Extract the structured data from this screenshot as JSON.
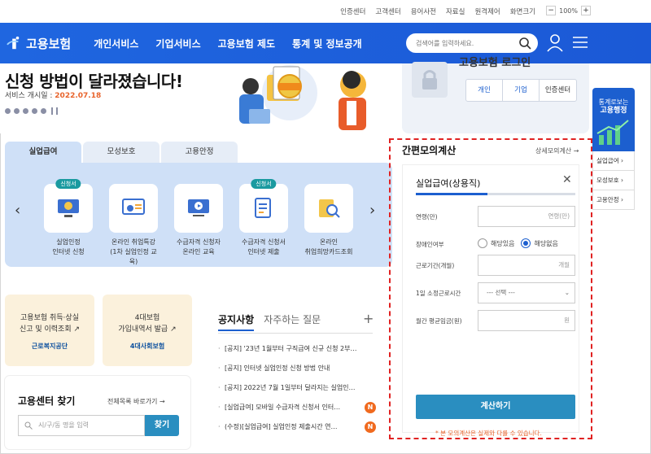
{
  "util": {
    "links": [
      "인증센터",
      "고객센터",
      "용어사전",
      "자료실",
      "원격제어",
      "화면크기"
    ],
    "zoom": {
      "minus": "−",
      "value": "100%",
      "plus": "+"
    }
  },
  "header": {
    "logo": "고용보험",
    "nav": [
      "개인서비스",
      "기업서비스",
      "고용보험 제도",
      "통계 및 정보공개"
    ],
    "search_placeholder": "검색어를 입력하세요."
  },
  "hero": {
    "title": "신청 방법이 달라졌습니다!",
    "date_label": "서비스 개시일 : ",
    "date_value": "2022.07.18"
  },
  "login": {
    "title": "고용보험 로그인",
    "buttons": [
      "개인",
      "기업",
      "인증센터"
    ]
  },
  "tabs": [
    "실업급여",
    "모성보호",
    "고용안정"
  ],
  "services": [
    {
      "line1": "실업인정",
      "line2": "인터넷 신청",
      "badge": "신청서"
    },
    {
      "line1": "온라인 취업특강",
      "line2": "(1차 실업인정 교육)",
      "badge": ""
    },
    {
      "line1": "수급자격 신청자",
      "line2": "온라인 교육",
      "badge": ""
    },
    {
      "line1": "수급자격 신청서",
      "line2": "인터넷 제출",
      "badge": "신청서"
    },
    {
      "line1": "온라인",
      "line2": "취업희망카드조회",
      "badge": ""
    }
  ],
  "quick": [
    {
      "line1": "고용보험 취득·상실",
      "line2": "신고 및 이력조회",
      "org": "근로복지공단"
    },
    {
      "line1": "4대보험",
      "line2": "가입내역서 발급",
      "org": "4대사회보험"
    }
  ],
  "center": {
    "title": "고용센터 찾기",
    "all": "전체목록 바로가기",
    "placeholder": "시/구/동 명을 입력",
    "button": "찾기"
  },
  "notice": {
    "tab1": "공지사항",
    "tab2": "자주하는 질문",
    "items": [
      {
        "text": "[공지] '23년 1월부터 구직급여 신규 신청 2부…",
        "new": false
      },
      {
        "text": "[공지] 인터넷 실업인정 신청 방법 안내",
        "new": false
      },
      {
        "text": "[공지] 2022년 7월 1일부터 달라지는 실업인…",
        "new": false
      },
      {
        "text": "[실업급여] 모바일 수급자격 신청서 인터…",
        "new": true
      },
      {
        "text": "(수정)[실업급여] 실업인정 제출시간 연…",
        "new": true
      }
    ],
    "new_label": "N"
  },
  "calc": {
    "title": "간편모의계산",
    "more": "상세모의계산",
    "subtitle": "실업급여(상용직)",
    "progress": 0.45,
    "age_label": "연령(만)",
    "age_placeholder": "연령(만)",
    "disability_label": "장애인여부",
    "opt_yes": "해당있음",
    "opt_no": "해당없음",
    "period_label": "근로기간(개월)",
    "period_placeholder": "개월",
    "hours_label": "1일 소정근로시간",
    "hours_select": "--- 선택 ---",
    "wage_label": "월간 평균임금(원)",
    "wage_placeholder": "원",
    "button": "계산하기",
    "note": "* 본 모의계산은 실제와 다를 수 있습니다."
  },
  "side": {
    "top1": "통계로보는",
    "top2": "고용행정",
    "links": [
      "실업급여",
      "모성보호",
      "고용안정"
    ]
  },
  "colors": {
    "brand": "#1c5fcf",
    "accent": "#e8632b",
    "dash": "#e02222"
  }
}
